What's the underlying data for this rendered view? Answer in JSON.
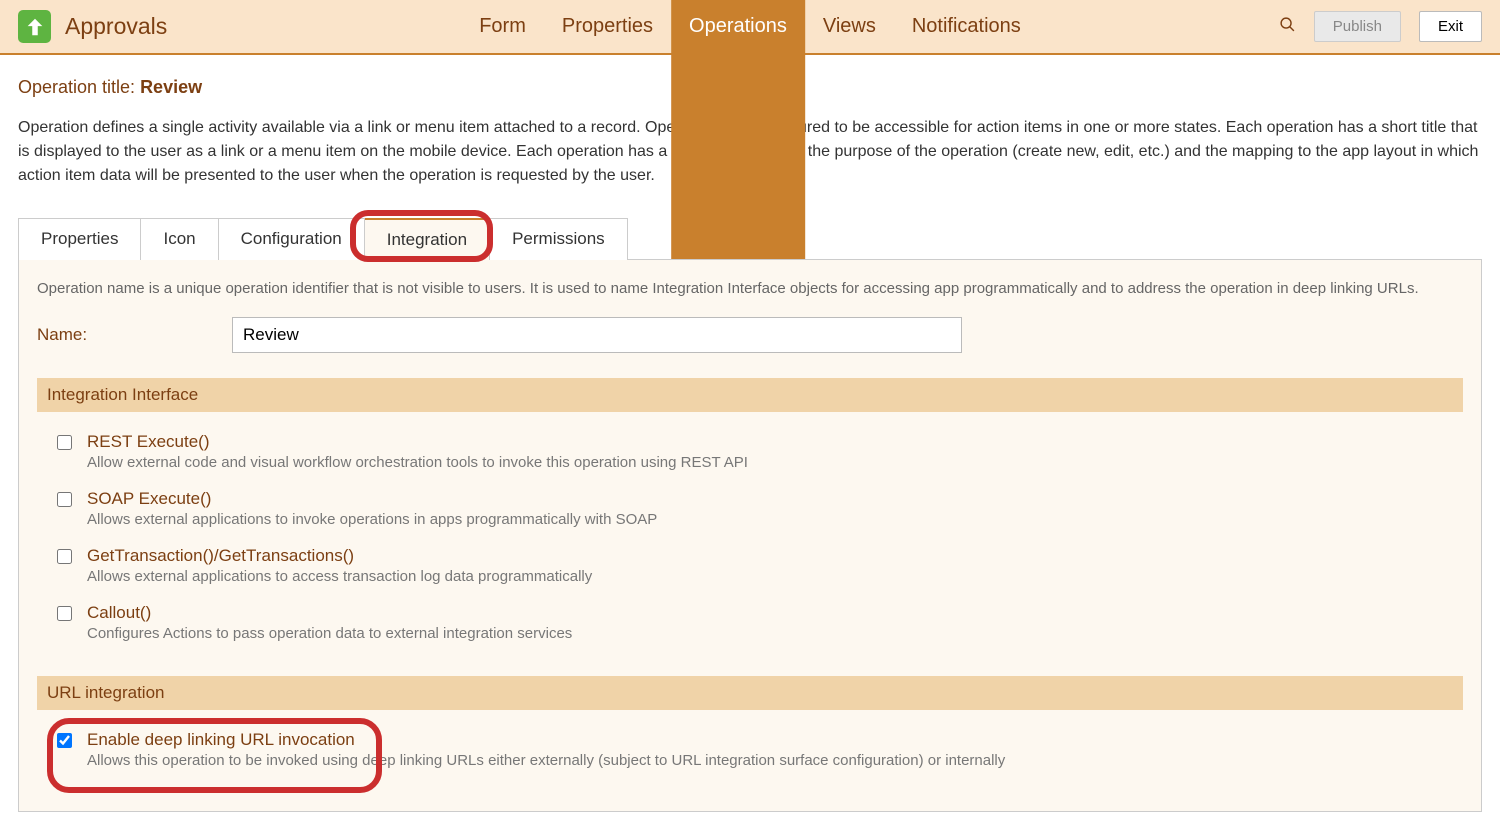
{
  "header": {
    "app_title": "Approvals",
    "nav": [
      "Form",
      "Properties",
      "Operations",
      "Views",
      "Notifications"
    ],
    "active_nav_index": 2,
    "publish_label": "Publish",
    "exit_label": "Exit"
  },
  "operation": {
    "title_prefix": "Operation title: ",
    "title_value": "Review",
    "description": "Operation defines a single activity available via a link or menu item attached to a record. Operations are configured to be accessible for action items in one or more states. Each operation has a short title that is displayed to the user as a link or a menu item on the mobile device. Each operation has a type which defines the purpose of the operation (create new, edit, etc.) and the mapping to the app layout in which action item data will be presented to the user when the operation is requested by the user."
  },
  "tabs": [
    "Properties",
    "Icon",
    "Configuration",
    "Integration",
    "Permissions"
  ],
  "active_tab_index": 3,
  "integration_panel": {
    "helper_text": "Operation name is a unique operation identifier that is not visible to users. It is used to name Integration Interface objects for accessing app programmatically and to address the operation in deep linking URLs.",
    "name_label": "Name:",
    "name_value": "Review",
    "section1_title": "Integration Interface",
    "items": [
      {
        "title": "REST Execute()",
        "desc": "Allow external code and visual workflow orchestration tools to invoke this operation using REST API",
        "checked": false
      },
      {
        "title": "SOAP Execute()",
        "desc": "Allows external applications to invoke operations in apps programmatically with SOAP",
        "checked": false
      },
      {
        "title": "GetTransaction()/GetTransactions()",
        "desc": "Allows external applications to access transaction log data programmatically",
        "checked": false
      },
      {
        "title": "Callout()",
        "desc": "Configures Actions to pass operation data to external integration services",
        "checked": false
      }
    ],
    "section2_title": "URL integration",
    "deeplink": {
      "title": "Enable deep linking URL invocation",
      "desc": "Allows this operation to be invoked using deep linking URLs either externally (subject to URL integration surface configuration) or internally",
      "checked": true
    }
  }
}
